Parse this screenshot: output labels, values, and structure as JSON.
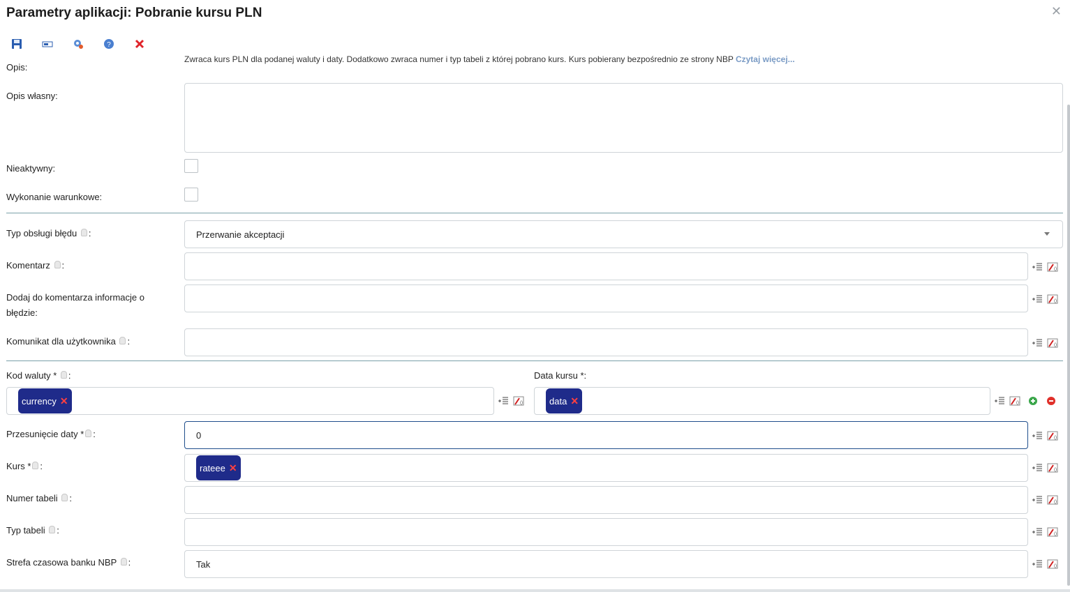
{
  "dialog": {
    "title": "Parametry aplikacji: Pobranie kursu PLN",
    "close_icon": "close-icon"
  },
  "toolbar": {
    "icons": [
      "save-icon",
      "window-icon",
      "settings-icon",
      "help-icon",
      "cancel-icon"
    ]
  },
  "form": {
    "opis_label": "Opis:",
    "opis_text": "Zwraca kurs PLN dla podanej waluty i daty. Dodatkowo zwraca numer i typ tabeli z której pobrano kurs. Kurs pobierany bezpośrednio ze strony NBP",
    "opis_link": "Czytaj więcej...",
    "opis_wlasny_label": "Opis własny:",
    "nieaktywny_label": "Nieaktywny:",
    "wykonanie_label": "Wykonanie warunkowe:",
    "typ_obslugi_label": "Typ obsługi błędu",
    "typ_obslugi_value": "Przerwanie akceptacji",
    "komentarz_label": "Komentarz",
    "dodaj_label_1": "Dodaj do komentarza informacje o",
    "dodaj_label_2": "błędzie:",
    "komunikat_label": "Komunikat dla użytkownika",
    "kod_waluty_label": "Kod waluty *",
    "kod_waluty_tag": "currency",
    "data_kursu_label": "Data kursu *:",
    "data_kursu_tag": "data",
    "przesuniecie_label": "Przesunięcie daty *",
    "przesuniecie_value": "0",
    "kurs_label": "Kurs *",
    "kurs_tag": "rateee",
    "numer_tabeli_label": "Numer tabeli",
    "typ_tabeli_label": "Typ tabeli",
    "strefa_label": "Strefa czasowa banku NBP",
    "strefa_value": "Tak",
    "colon": ":",
    "remove_mark": "✕"
  }
}
